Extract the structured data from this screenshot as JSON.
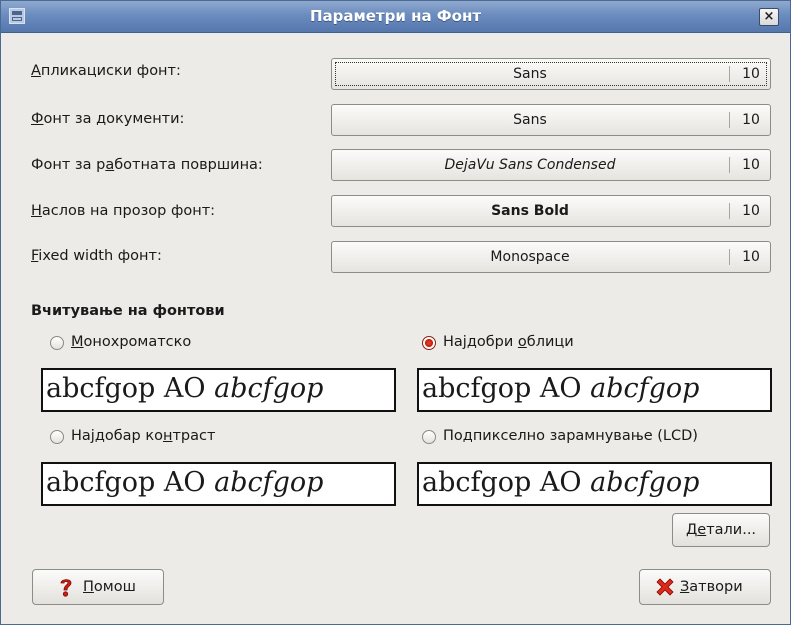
{
  "window": {
    "title": "Параметри на Фонт",
    "close_glyph": "×"
  },
  "fonts": [
    {
      "label_mn": "А",
      "label_rest": "пликациски фонт:",
      "name": "Sans",
      "size": "10",
      "style": "normal"
    },
    {
      "label_mn": "Ф",
      "label_rest": "онт за документи:",
      "name": "Sans",
      "size": "10",
      "style": "normal"
    },
    {
      "label_pre": "Фонт за р",
      "label_mn": "а",
      "label_rest": "ботната површина:",
      "name": "DejaVu Sans Condensed",
      "size": "10",
      "style": "italic"
    },
    {
      "label_mn": "Н",
      "label_rest": "аслов на прозор фонт:",
      "name": "Sans Bold",
      "size": "10",
      "style": "bold"
    },
    {
      "label_mn": "F",
      "label_rest": "ixed width фонт:",
      "name": "Monospace",
      "size": "10",
      "style": "normal"
    }
  ],
  "rendering": {
    "title": "Вчитување на фонтови",
    "options": [
      {
        "pre": "",
        "mn": "М",
        "rest": "онохроматско",
        "selected": false
      },
      {
        "pre": "Најдобри ",
        "mn": "о",
        "rest": "блици",
        "selected": true
      },
      {
        "pre": "Најдобар ко",
        "mn": "н",
        "rest": "траст",
        "selected": false
      },
      {
        "pre": "По",
        "mn": "д",
        "rest": "пикселно зарамнување (LCD)",
        "selected": false
      }
    ],
    "sample_regular": "abcfgop AO ",
    "sample_italic": "abcfgop"
  },
  "buttons": {
    "details_pre": "Д",
    "details_mn": "е",
    "details_rest": "тали...",
    "help_mn": "П",
    "help_rest": "омош",
    "close_mn": "З",
    "close_rest": "атвори"
  },
  "icons": {
    "help": "question-mark-icon",
    "close": "red-x-icon",
    "app": "font-preferences-icon"
  }
}
